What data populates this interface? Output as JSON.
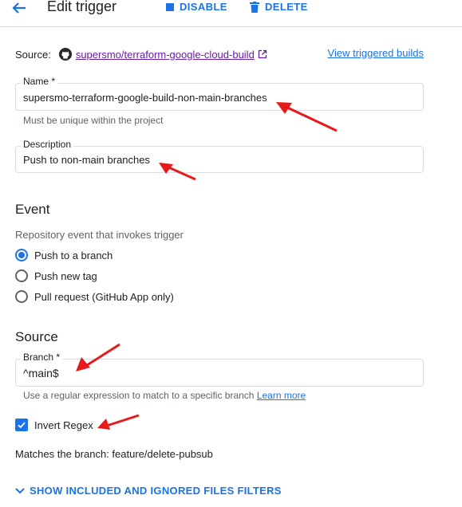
{
  "header": {
    "title": "Edit trigger",
    "disable_label": "DISABLE",
    "delete_label": "DELETE"
  },
  "source_row": {
    "label": "Source:",
    "repo": "supersmo/terraform-google-cloud-build",
    "view_builds": "View triggered builds"
  },
  "name_field": {
    "label": "Name *",
    "value": "supersmo-terraform-google-build-non-main-branches",
    "helper": "Must be unique within the project"
  },
  "description_field": {
    "label": "Description",
    "value": "Push to non-main branches"
  },
  "event": {
    "heading": "Event",
    "subtext": "Repository event that invokes trigger",
    "options": [
      {
        "label": "Push to a branch",
        "selected": true
      },
      {
        "label": "Push new tag",
        "selected": false
      },
      {
        "label": "Pull request (GitHub App only)",
        "selected": false
      }
    ]
  },
  "source": {
    "heading": "Source",
    "branch_label": "Branch *",
    "branch_value": "^main$",
    "branch_helper": "Use a regular expression to match to a specific branch",
    "learn_more": "Learn more",
    "invert_regex_label": "Invert Regex",
    "invert_regex_checked": true,
    "matches": "Matches the branch: feature/delete-pubsub"
  },
  "filters_toggle": "SHOW INCLUDED AND IGNORED FILES FILTERS",
  "colors": {
    "accent": "#1a73e8",
    "visited_link": "#681da8",
    "annotation_arrow": "#e8191b"
  }
}
